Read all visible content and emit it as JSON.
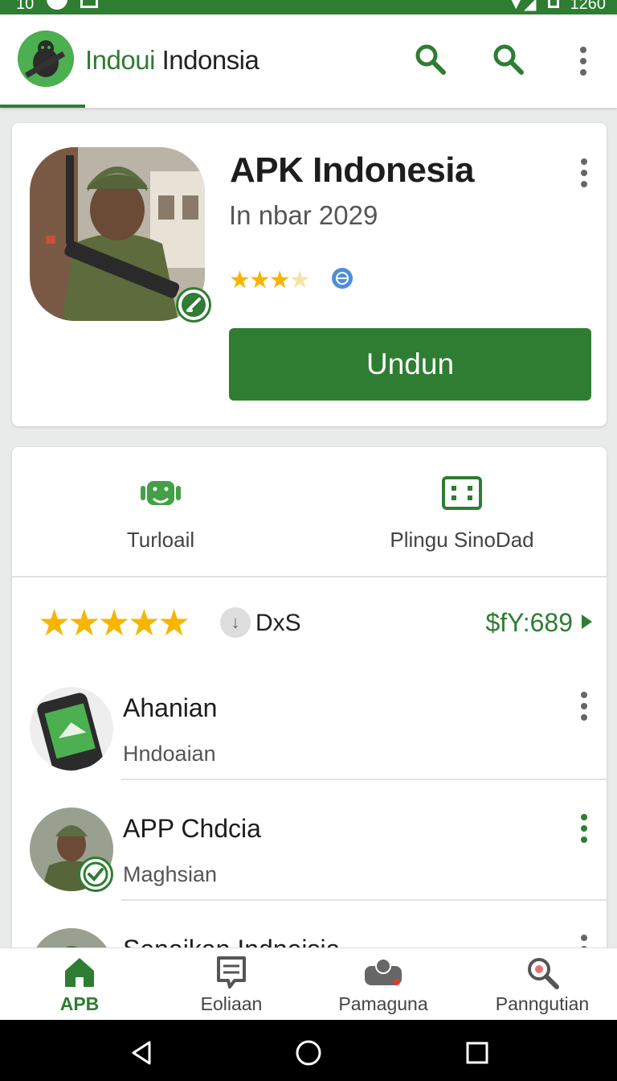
{
  "status_bar": {
    "time_left": "10",
    "time_right": "1260"
  },
  "app_bar": {
    "title_green": "Indoui",
    "title_dark": " Indonsia",
    "icons": [
      "search-icon",
      "search-icon",
      "more-vert-icon"
    ]
  },
  "hero": {
    "name": "APK Indonesia",
    "subtitle": "In nbar 2029",
    "rating_stars": 3.5,
    "install_label": "Undun"
  },
  "tabs": [
    {
      "icon": "android-icon",
      "label": "Turloail"
    },
    {
      "icon": "screen-icon",
      "label": "Plingu SinoDad"
    }
  ],
  "rating_row": {
    "stars": 5,
    "download_text": "DxS",
    "price": "$fY:689"
  },
  "list": [
    {
      "name": "Ahanian",
      "subtitle": "Hndoaian",
      "thumb": "phone-icon"
    },
    {
      "name": "APP Chdcia",
      "subtitle": "Maghsian",
      "thumb": "soldier-avatar"
    },
    {
      "name": "Senaikan Indneisia",
      "subtitle": "",
      "thumb": "soldier-avatar"
    }
  ],
  "bottom_nav": [
    {
      "label": "APB",
      "icon": "home-icon",
      "active": true
    },
    {
      "label": "Eoliaan",
      "icon": "message-icon",
      "active": false
    },
    {
      "label": "Pamaguna",
      "icon": "people-icon",
      "active": false
    },
    {
      "label": "Panngutian",
      "icon": "search-icon",
      "active": false
    }
  ],
  "colors": {
    "brand_green": "#2e7d32",
    "star": "#f7b500"
  }
}
